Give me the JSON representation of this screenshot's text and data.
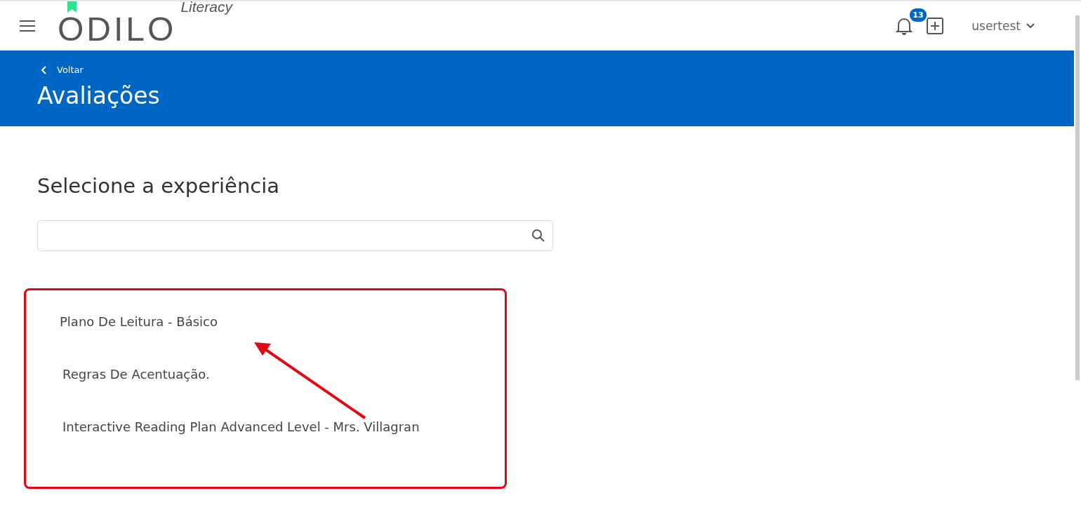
{
  "header": {
    "logo": "ODILO",
    "logo_tag": "Literacy",
    "notifications": "13",
    "user": "usertest"
  },
  "banner": {
    "back": "Voltar",
    "title": "Avaliações"
  },
  "section": {
    "title": "Selecione a experiência"
  },
  "experiences": [
    {
      "label": "Plano De Leitura - Básico"
    },
    {
      "label": "Regras De Acentuação."
    },
    {
      "label": "Interactive Reading Plan Advanced Level - Mrs. Villagran"
    }
  ]
}
